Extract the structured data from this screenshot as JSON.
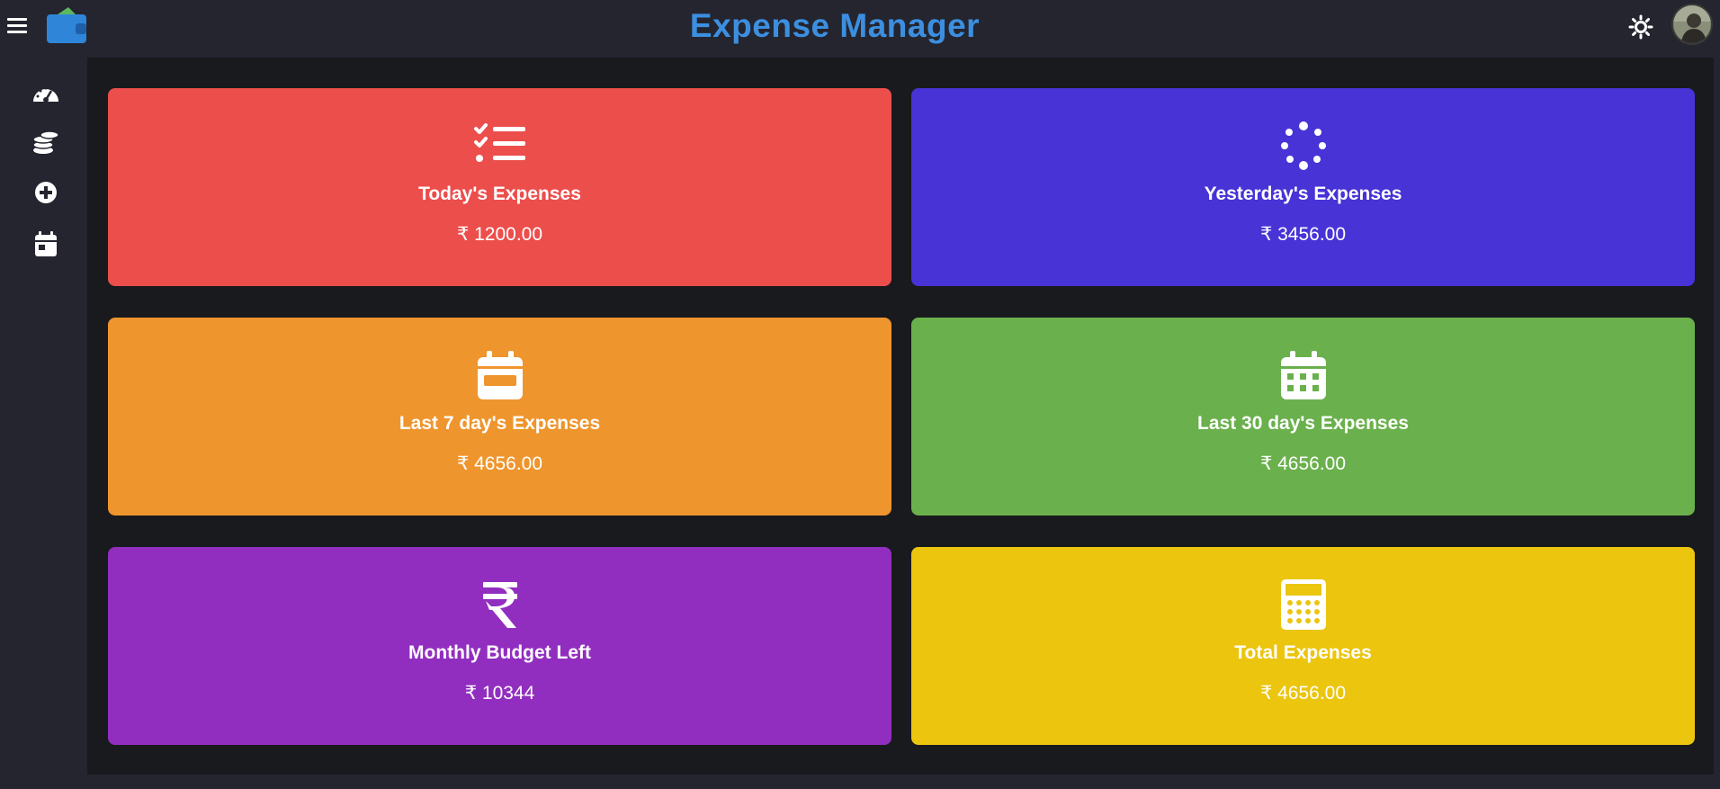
{
  "header": {
    "title": "Expense Manager",
    "menu_icon": "hamburger-icon",
    "logo_icon": "wallet-icon",
    "theme_icon": "sun-icon",
    "avatar_icon": "user-avatar"
  },
  "sidebar": {
    "items": [
      {
        "icon": "dashboard-gauge-icon"
      },
      {
        "icon": "coins-icon"
      },
      {
        "icon": "add-circle-icon"
      },
      {
        "icon": "calendar-day-icon"
      }
    ]
  },
  "cards": [
    {
      "label": "Today's Expenses",
      "value": "₹ 1200.00",
      "color": "#ec4e4c",
      "icon": "list-check-icon"
    },
    {
      "label": "Yesterday's Expenses",
      "value": "₹ 3456.00",
      "color": "#4733d6",
      "icon": "spinner-icon"
    },
    {
      "label": "Last 7 day's Expenses",
      "value": "₹ 4656.00",
      "color": "#ef952d",
      "icon": "calendar-week-icon"
    },
    {
      "label": "Last 30 day's Expenses",
      "value": "₹ 4656.00",
      "color": "#6ab04c",
      "icon": "calendar-month-icon"
    },
    {
      "label": "Monthly Budget Left",
      "value": "₹ 10344",
      "color": "#912ebf",
      "icon": "rupee-icon"
    },
    {
      "label": "Total Expenses",
      "value": "₹ 4656.00",
      "color": "#ecc50f",
      "icon": "calculator-icon"
    }
  ]
}
